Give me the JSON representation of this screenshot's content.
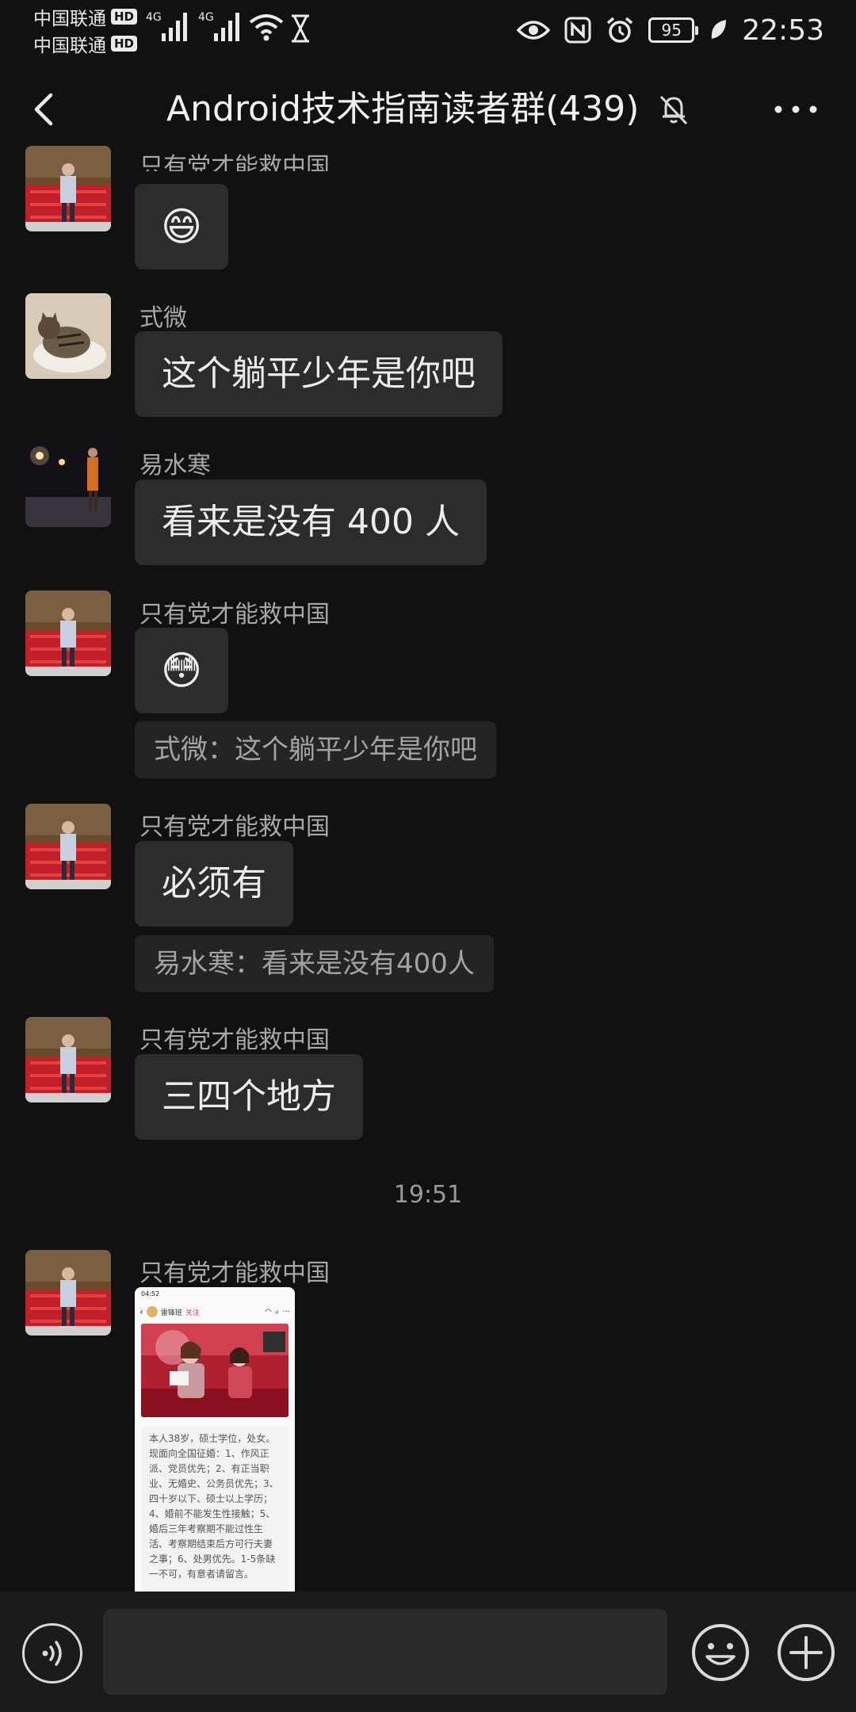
{
  "status_bar": {
    "carrier_1": "中国联通",
    "carrier_2": "中国联通",
    "hd_badge": "HD",
    "network_1": "4G",
    "network_2": "4G",
    "battery_level": "95",
    "time": "22:53"
  },
  "header": {
    "title": "Android技术指南读者群(439)",
    "back_icon": "chevron-left-icon",
    "mute_icon": "bell-off-icon",
    "more_icon": "more-horizontal-icon"
  },
  "messages": [
    {
      "sender": "只有党才能救中国",
      "type": "emoji",
      "emoji": "😄"
    },
    {
      "sender": "式微",
      "type": "text",
      "text": "这个躺平少年是你吧"
    },
    {
      "sender": "易水寒",
      "type": "text",
      "text": "看来是没有 400 人"
    },
    {
      "sender": "只有党才能救中国",
      "type": "emoji",
      "emoji": "😳",
      "quote": "式微：这个躺平少年是你吧"
    },
    {
      "sender": "只有党才能救中国",
      "type": "text",
      "text": "必须有",
      "quote": "易水寒：看来是没有400人"
    },
    {
      "sender": "只有党才能救中国",
      "type": "text",
      "text": "三四个地方"
    }
  ],
  "timestamp": "19:51",
  "image_message": {
    "sender": "只有党才能救中国",
    "screenshot_time": "04:52",
    "author": "雷锋班",
    "follow": "关注",
    "body": "本人38岁，硕士学位，处女。现面向全国征婚：1、作风正派、党员优先；2、有正当职业、无婚史、公务员优先；3、四十岁以下、硕士以上学历；4、婚前不能发生性接触；5、婚后三年考察期不能过性生活、考察期结束后方可行夫妻之事；6、处男优先。1-5条缺一不可，有意者请留言。"
  },
  "input_bar": {
    "voice_icon": "voice-icon",
    "input_value": "",
    "emoji_icon": "emoji-icon",
    "plus_icon": "plus-circle-icon"
  },
  "colors": {
    "background": "#111111",
    "bubble": "#2c2c2c",
    "quote": "#242424",
    "sender_text": "#a8a8a8"
  }
}
